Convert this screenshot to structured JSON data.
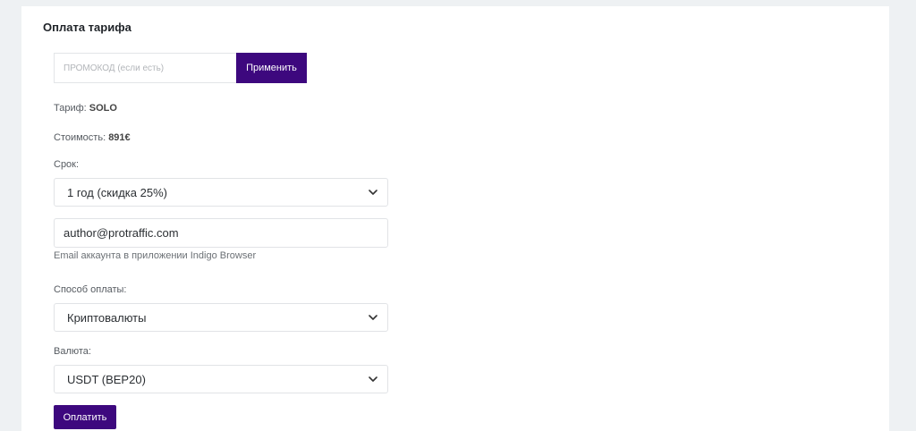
{
  "page": {
    "title": "Оплата тарифа"
  },
  "promo": {
    "placeholder": "ПРОМОКОД (если есть)",
    "value": "",
    "apply_label": "Применить"
  },
  "tariff": {
    "label": "Тариф: ",
    "value": "SOLO"
  },
  "cost": {
    "label": "Стоимость: ",
    "value": "891€"
  },
  "term": {
    "label": "Срок:",
    "selected": "1 год (скидка 25%)"
  },
  "email": {
    "value": "author@protraffic.com",
    "help": "Email аккаунта в приложении Indigo Browser"
  },
  "payment_method": {
    "label": "Способ оплаты:",
    "selected": "Криптовалюты"
  },
  "currency": {
    "label": "Валюта:",
    "selected": "USDT (BEP20)"
  },
  "pay": {
    "label": "Оплатить"
  },
  "colors": {
    "accent": "#3d087e",
    "background": "#eef1f3"
  }
}
